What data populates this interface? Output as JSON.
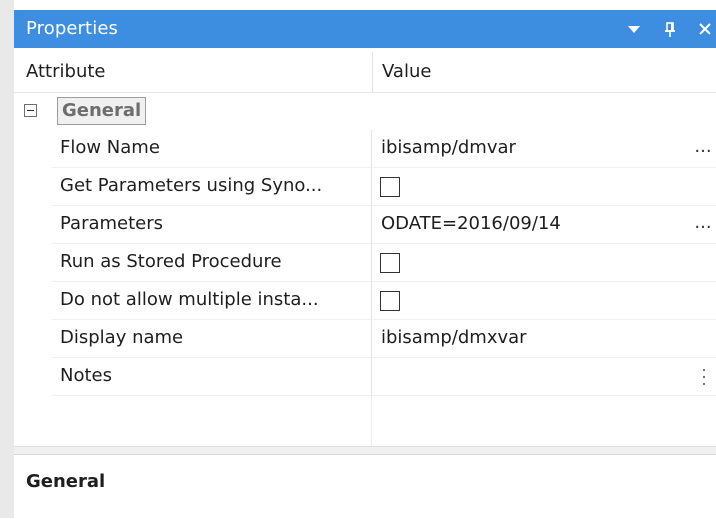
{
  "panel": {
    "title": "Properties",
    "buttons": {
      "dropdown_glyph": "▼",
      "pin_glyph": "q",
      "close_glyph": "✕"
    }
  },
  "columns": {
    "attribute": "Attribute",
    "value": "Value"
  },
  "category": {
    "label": "General",
    "expanded": true
  },
  "properties": [
    {
      "name": "Flow Name",
      "value": "ibisamp/dmvar",
      "type": "text",
      "has_ellipsis": true
    },
    {
      "name": "Get Parameters using Syno...",
      "value": "",
      "type": "checkbox",
      "checked": false
    },
    {
      "name": "Parameters",
      "value": "ODATE=2016/09/14",
      "type": "text",
      "has_ellipsis": true
    },
    {
      "name": "Run as Stored Procedure",
      "value": "",
      "type": "checkbox",
      "checked": false
    },
    {
      "name": "Do not allow multiple insta...",
      "value": "",
      "type": "checkbox",
      "checked": false
    },
    {
      "name": "Display name",
      "value": "ibisamp/dmxvar",
      "type": "text"
    },
    {
      "name": "Notes",
      "value": "",
      "type": "text",
      "has_kebab": true
    }
  ],
  "ellipsis_label": "...",
  "description": {
    "title": "General"
  },
  "colors": {
    "titlebar": "#3d8ee0",
    "title_text": "#ffffff"
  }
}
